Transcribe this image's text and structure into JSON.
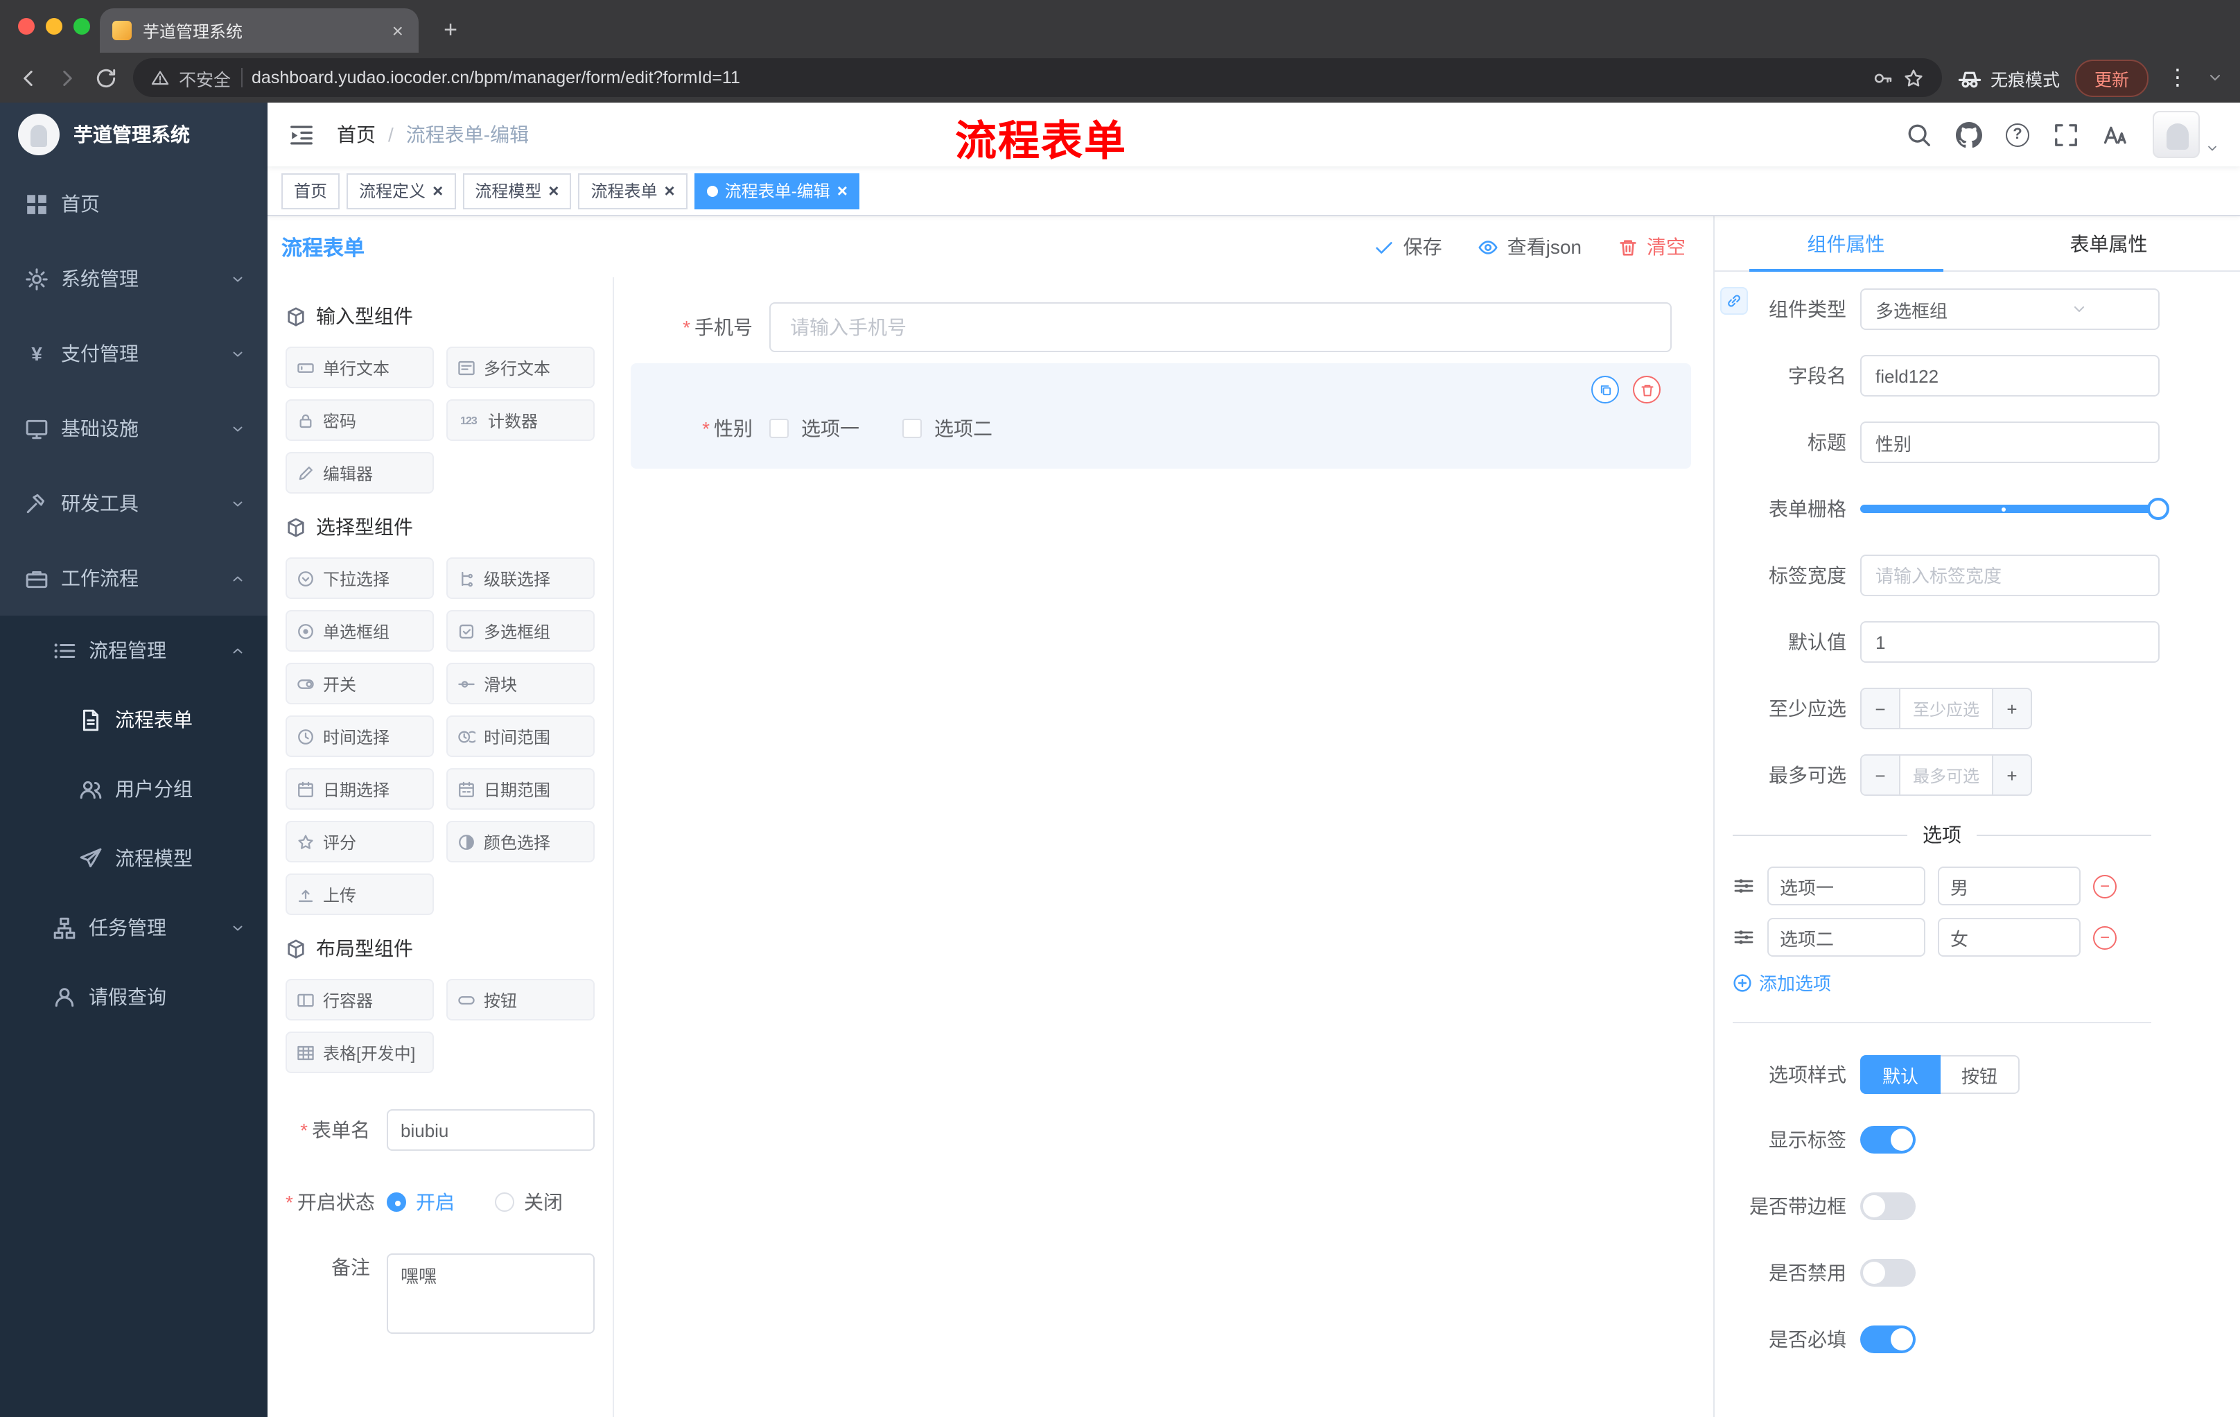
{
  "glyphs": {
    "required": "*",
    "close": "×",
    "plus": "+",
    "minus": "−",
    "dots": "⋮",
    "question": "?",
    "yen": "¥",
    "slash": "/",
    "counter": "123"
  },
  "colors": {
    "primary": "#409eff",
    "danger": "#f56c6c",
    "annotation": "#ff0000",
    "sidebar": "#1f2d3d"
  },
  "browser": {
    "tab_title": "芋道管理系统",
    "security_label": "不安全",
    "url": "dashboard.yudao.iocoder.cn/bpm/manager/form/edit?formId=11",
    "incognito_label": "无痕模式",
    "update_label": "更新"
  },
  "sidebar": {
    "logo_title": "芋道管理系统",
    "items": [
      {
        "label": "首页"
      },
      {
        "label": "系统管理"
      },
      {
        "label": "支付管理"
      },
      {
        "label": "基础设施"
      },
      {
        "label": "研发工具"
      },
      {
        "label": "工作流程"
      },
      {
        "label": "流程管理"
      },
      {
        "label": "流程表单"
      },
      {
        "label": "用户分组"
      },
      {
        "label": "流程模型"
      },
      {
        "label": "任务管理"
      },
      {
        "label": "请假查询"
      }
    ]
  },
  "navbar": {
    "breadcrumb_home": "首页",
    "breadcrumb_current": "流程表单-编辑",
    "annotation": "流程表单"
  },
  "tags": [
    {
      "label": "首页"
    },
    {
      "label": "流程定义"
    },
    {
      "label": "流程模型"
    },
    {
      "label": "流程表单"
    },
    {
      "label": "流程表单-编辑"
    }
  ],
  "designer": {
    "title": "流程表单",
    "save_label": "保存",
    "view_json_label": "查看json",
    "clear_label": "清空"
  },
  "palette": {
    "group1_title": "输入型组件",
    "group2_title": "选择型组件",
    "group3_title": "布局型组件",
    "group1": [
      "单行文本",
      "多行文本",
      "密码",
      "计数器",
      "编辑器"
    ],
    "group2": [
      "下拉选择",
      "级联选择",
      "单选框组",
      "多选框组",
      "开关",
      "滑块",
      "时间选择",
      "时间范围",
      "日期选择",
      "日期范围",
      "评分",
      "颜色选择",
      "上传"
    ],
    "group3": [
      "行容器",
      "按钮",
      "表格[开发中]"
    ],
    "form_name_label": "表单名",
    "form_name_value": "biubiu",
    "status_label": "开启状态",
    "status_on": "开启",
    "status_off": "关闭",
    "remark_label": "备注",
    "remark_value": "嘿嘿"
  },
  "canvas": {
    "phone_label": "手机号",
    "phone_placeholder": "请输入手机号",
    "gender_label": "性别",
    "gender_opt1": "选项一",
    "gender_opt2": "选项二"
  },
  "props": {
    "tab_component": "组件属性",
    "tab_form": "表单属性",
    "component_type_label": "组件类型",
    "component_type_value": "多选框组",
    "field_name_label": "字段名",
    "field_name_value": "field122",
    "title_label": "标题",
    "title_value": "性别",
    "grid_label": "表单栅格",
    "label_width_label": "标签宽度",
    "label_width_placeholder": "请输入标签宽度",
    "default_label": "默认值",
    "default_value": "1",
    "min_label": "至少应选",
    "min_placeholder": "至少应选",
    "max_label": "最多可选",
    "max_placeholder": "最多可选",
    "options_title": "选项",
    "opt1_label": "选项一",
    "opt1_value": "男",
    "opt2_label": "选项二",
    "opt2_value": "女",
    "add_option_label": "添加选项",
    "style_label": "选项样式",
    "style_default": "默认",
    "style_button": "按钮",
    "switch1_label": "显示标签",
    "switch2_label": "是否带边框",
    "switch3_label": "是否禁用",
    "switch4_label": "是否必填"
  }
}
